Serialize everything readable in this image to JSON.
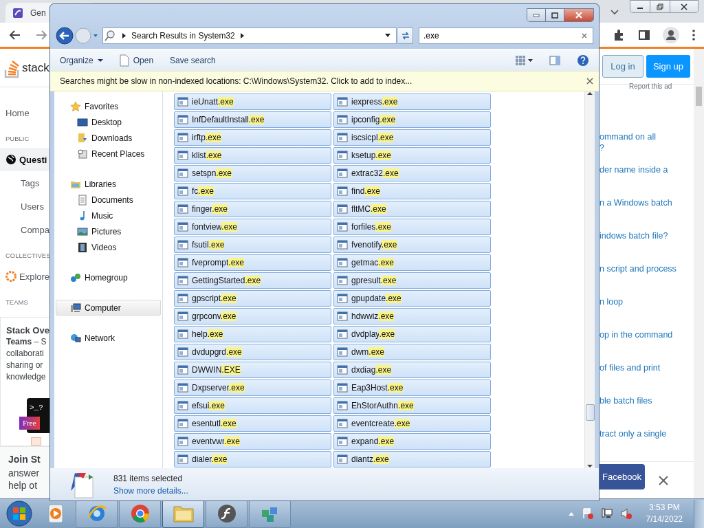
{
  "browser": {
    "tab": {
      "title": "Gen"
    },
    "site": {
      "logo_text": "stack",
      "login": "Log in",
      "signup": "Sign up",
      "ad_note": "Report this ad",
      "nav": [
        {
          "label": "Home",
          "kind": "link",
          "selected": false
        },
        {
          "label": "PUBLIC",
          "kind": "heading",
          "selected": false
        },
        {
          "label": "Questi",
          "kind": "globe",
          "selected": true
        },
        {
          "label": "Tags",
          "kind": "sub",
          "selected": false
        },
        {
          "label": "Users",
          "kind": "sub",
          "selected": false
        },
        {
          "label": "Compa",
          "kind": "sub",
          "selected": false
        },
        {
          "label": "COLLECTIVES",
          "kind": "heading",
          "selected": false
        },
        {
          "label": "Explore",
          "kind": "collective",
          "selected": false
        },
        {
          "label": "TEAMS",
          "kind": "heading",
          "selected": false
        }
      ],
      "teams_card": {
        "title": "Stack Ove",
        "lines": [
          "**Teams** – S",
          "collaborati",
          "sharing or",
          "knowledge"
        ],
        "prompt": ">_?",
        "badge": "Free"
      },
      "related": [
        {
          "lines": [
            "ommand on all",
            "?"
          ]
        },
        {
          "lines": [
            "der name inside a"
          ]
        },
        {
          "lines": [
            "n a Windows batch"
          ]
        },
        {
          "lines": [
            "indows batch file?"
          ]
        },
        {
          "lines": [
            "n script and process"
          ]
        },
        {
          "lines": [
            "n loop"
          ]
        },
        {
          "lines": [
            "op in the command"
          ]
        },
        {
          "lines": [
            "of files and print"
          ]
        },
        {
          "lines": [
            "ble batch files"
          ]
        },
        {
          "lines": [
            "tract only a single"
          ]
        }
      ],
      "join": {
        "title": "Join St",
        "lines": [
          "answer",
          "help ot"
        ]
      },
      "facebook": "Facebook"
    }
  },
  "explorer": {
    "address": "Search Results in System32",
    "search": ".exe",
    "toolbar": [
      "Organize",
      "Open",
      "Save search"
    ],
    "info_bar": "Searches might be slow in non-indexed locations: C:\\Windows\\System32. Click to add to index...",
    "nav": [
      {
        "label": "Favorites",
        "kind": "favorites",
        "selected": false,
        "children": [
          {
            "label": "Desktop",
            "kind": "desktop",
            "selected": false
          },
          {
            "label": "Downloads",
            "kind": "downloads",
            "selected": false
          },
          {
            "label": "Recent Places",
            "kind": "recent",
            "selected": false
          }
        ]
      },
      {
        "label": "Libraries",
        "kind": "libraries",
        "selected": false,
        "children": [
          {
            "label": "Documents",
            "kind": "documents",
            "selected": false
          },
          {
            "label": "Music",
            "kind": "music",
            "selected": false
          },
          {
            "label": "Pictures",
            "kind": "pictures",
            "selected": false
          },
          {
            "label": "Videos",
            "kind": "videos",
            "selected": false
          }
        ]
      },
      {
        "label": "Homegroup",
        "kind": "homegroup",
        "selected": false
      },
      {
        "label": "Computer",
        "kind": "computer",
        "selected": true
      },
      {
        "label": "Network",
        "kind": "network",
        "selected": false
      }
    ],
    "files": [
      {
        "stem": "ieUnatt",
        "match": ".exe",
        "selected": true
      },
      {
        "stem": "iexpress",
        "match": ".exe",
        "selected": true
      },
      {
        "stem": "InfDefaultInstall",
        "match": ".exe",
        "selected": true
      },
      {
        "stem": "ipconfig",
        "match": ".exe",
        "selected": true
      },
      {
        "stem": "irftp",
        "match": ".exe",
        "selected": true
      },
      {
        "stem": "iscsicpl",
        "match": ".exe",
        "selected": true
      },
      {
        "stem": "klist",
        "match": ".exe",
        "selected": true
      },
      {
        "stem": "ksetup",
        "match": ".exe",
        "selected": true
      },
      {
        "stem": "setspn",
        "match": ".exe",
        "selected": true
      },
      {
        "stem": "extrac32",
        "match": ".exe",
        "selected": true
      },
      {
        "stem": "fc",
        "match": ".exe",
        "selected": true
      },
      {
        "stem": "find",
        "match": ".exe",
        "selected": true
      },
      {
        "stem": "finger",
        "match": ".exe",
        "selected": true
      },
      {
        "stem": "fltMC",
        "match": ".exe",
        "selected": true
      },
      {
        "stem": "fontview",
        "match": ".exe",
        "selected": true
      },
      {
        "stem": "forfiles",
        "match": ".exe",
        "selected": true
      },
      {
        "stem": "fsutil",
        "match": ".exe",
        "selected": true
      },
      {
        "stem": "fvenotify",
        "match": ".exe",
        "selected": true
      },
      {
        "stem": "fveprompt",
        "match": ".exe",
        "selected": true
      },
      {
        "stem": "getmac",
        "match": ".exe",
        "selected": true
      },
      {
        "stem": "GettingStarted",
        "match": ".exe",
        "selected": true
      },
      {
        "stem": "gpresult",
        "match": ".exe",
        "selected": true
      },
      {
        "stem": "gpscript",
        "match": ".exe",
        "selected": true
      },
      {
        "stem": "gpupdate",
        "match": ".exe",
        "selected": true
      },
      {
        "stem": "grpconv",
        "match": ".exe",
        "selected": true
      },
      {
        "stem": "hdwwiz",
        "match": ".exe",
        "selected": true
      },
      {
        "stem": "help",
        "match": ".exe",
        "selected": true
      },
      {
        "stem": "dvdplay",
        "match": ".exe",
        "selected": true
      },
      {
        "stem": "dvdupgrd",
        "match": ".exe",
        "selected": true
      },
      {
        "stem": "dwm",
        "match": ".exe",
        "selected": true
      },
      {
        "stem": "DWWIN",
        "match": ".EXE",
        "selected": true
      },
      {
        "stem": "dxdiag",
        "match": ".exe",
        "selected": true
      },
      {
        "stem": "Dxpserver",
        "match": ".exe",
        "selected": true
      },
      {
        "stem": "Eap3Host",
        "match": ".exe",
        "selected": true
      },
      {
        "stem": "efsui",
        "match": ".exe",
        "selected": true
      },
      {
        "stem": "EhStorAuthn",
        "match": ".exe",
        "selected": true
      },
      {
        "stem": "esentutl",
        "match": ".exe",
        "selected": true
      },
      {
        "stem": "eventcreate",
        "match": ".exe",
        "selected": true
      },
      {
        "stem": "eventvwr",
        "match": ".exe",
        "selected": true
      },
      {
        "stem": "expand",
        "match": ".exe",
        "selected": true
      },
      {
        "stem": "dialer",
        "match": ".exe",
        "selected": true
      },
      {
        "stem": "diantz",
        "match": ".exe",
        "selected": true
      }
    ],
    "details": {
      "count": "831 items selected",
      "link": "Show more details..."
    }
  },
  "taskbar": {
    "apps": [
      {
        "kind": "media",
        "active": false
      },
      {
        "kind": "ie",
        "active": false
      },
      {
        "kind": "chrome",
        "active": false
      },
      {
        "kind": "folder",
        "active": true
      },
      {
        "kind": "flash",
        "active": false
      },
      {
        "kind": "app",
        "active": false
      }
    ],
    "clock": {
      "time": "3:53 PM",
      "date": "7/14/2022"
    }
  }
}
